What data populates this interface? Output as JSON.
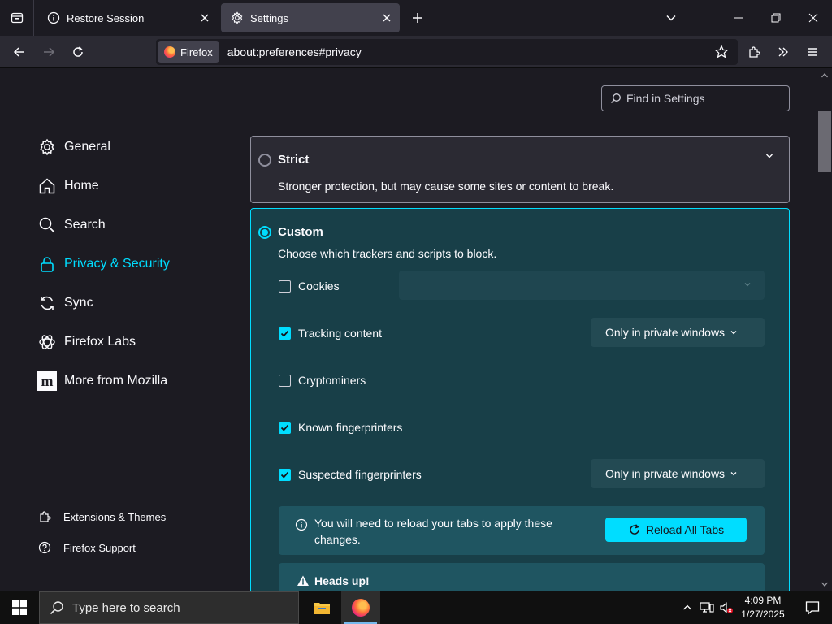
{
  "colors": {
    "accent": "#00ddff",
    "page_bg": "#1c1b22",
    "custom_panel_bg": "#183f48",
    "taskbar_bg": "#101010"
  },
  "tabs": {
    "restore": {
      "label": "Restore Session",
      "icon": "info-icon"
    },
    "settings": {
      "label": "Settings",
      "icon": "gear-icon",
      "selected": true
    }
  },
  "navbar": {
    "identity_label": "Firefox",
    "url": "about:preferences#privacy"
  },
  "find": {
    "placeholder": "Find in Settings"
  },
  "sidebar": {
    "items": [
      {
        "label": "General",
        "icon": "gear-icon"
      },
      {
        "label": "Home",
        "icon": "home-icon"
      },
      {
        "label": "Search",
        "icon": "search-icon"
      },
      {
        "label": "Privacy & Security",
        "icon": "lock-icon",
        "active": true
      },
      {
        "label": "Sync",
        "icon": "sync-icon"
      },
      {
        "label": "Firefox Labs",
        "icon": "flask-icon"
      },
      {
        "label": "More from Mozilla",
        "icon": "mozilla-icon"
      }
    ],
    "footer": [
      {
        "label": "Extensions & Themes",
        "icon": "puzzle-icon"
      },
      {
        "label": "Firefox Support",
        "icon": "help-icon"
      }
    ]
  },
  "strict": {
    "title": "Strict",
    "description": "Stronger protection, but may cause some sites or content to break."
  },
  "custom": {
    "title": "Custom",
    "description": "Choose which trackers and scripts to block.",
    "options": [
      {
        "label": "Cookies",
        "checked": false,
        "dropdown": ""
      },
      {
        "label": "Tracking content",
        "checked": true,
        "dropdown": "Only in private windows"
      },
      {
        "label": "Cryptominers",
        "checked": false
      },
      {
        "label": "Known fingerprinters",
        "checked": true
      },
      {
        "label": "Suspected fingerprinters",
        "checked": true,
        "dropdown": "Only in private windows"
      }
    ],
    "reload_message": "You will need to reload your tabs to apply these changes.",
    "reload_button": "Reload All Tabs",
    "heads_up": "Heads up!"
  },
  "taskbar": {
    "search_placeholder": "Type here to search",
    "time": "4:09 PM",
    "date": "1/27/2025"
  }
}
